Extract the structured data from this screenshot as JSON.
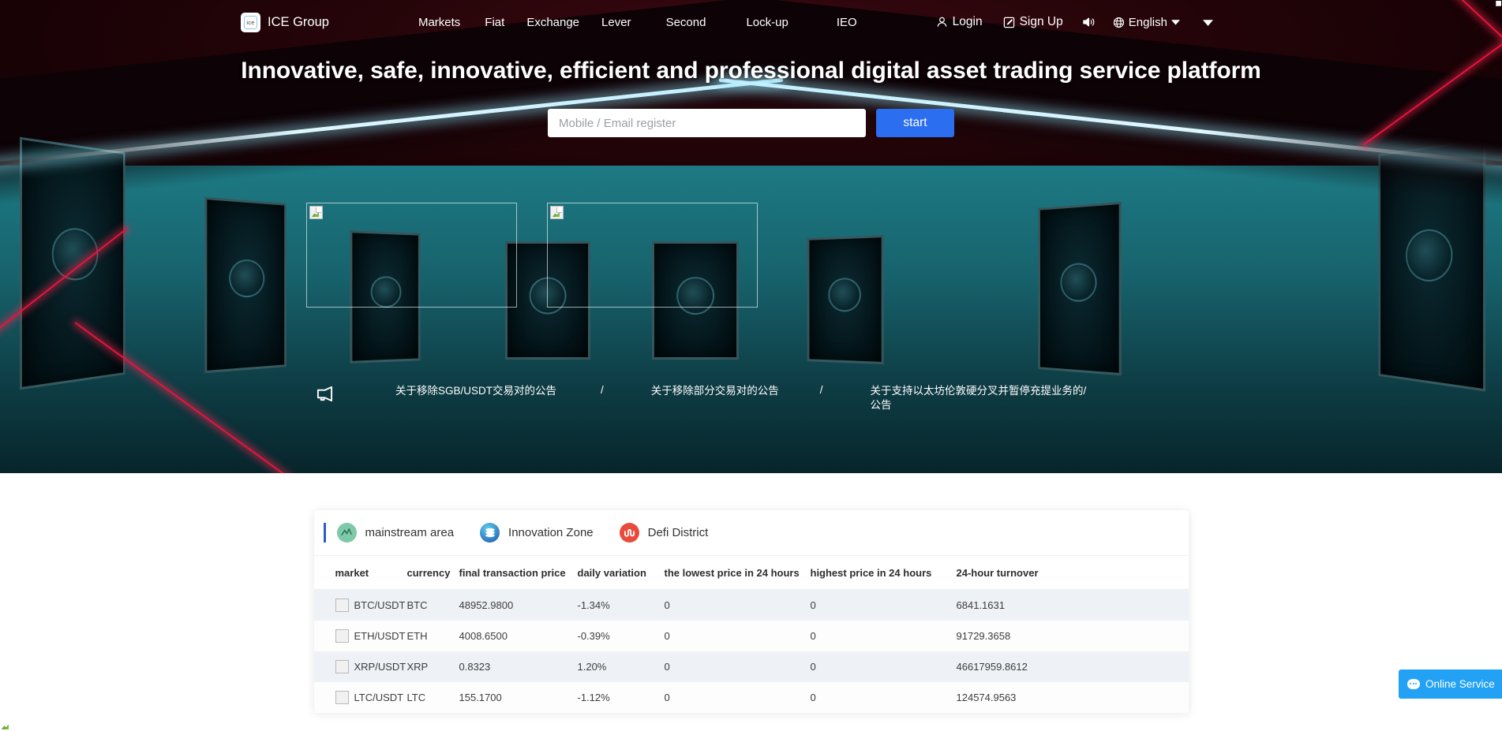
{
  "header": {
    "brand": {
      "logo_text": "ice",
      "name": "ICE Group"
    },
    "nav": [
      {
        "label": "Markets"
      },
      {
        "label": "Fiat"
      },
      {
        "label": "Exchange"
      },
      {
        "label": "Lever"
      },
      {
        "label": "Second"
      },
      {
        "label": "Lock-up"
      },
      {
        "label": "IEO"
      }
    ],
    "login_label": "Login",
    "signup_label": "Sign Up",
    "language_label": "English",
    "icons": {
      "user": "user-icon",
      "pencil": "pencil-icon",
      "sound": "sound-icon",
      "globe": "globe-icon",
      "caret": "chevron-down-icon"
    }
  },
  "hero": {
    "headline": "Innovative, safe, innovative, efficient and professional digital asset trading service platform",
    "register_placeholder": "Mobile / Email register",
    "register_value": "",
    "start_label": "start"
  },
  "announcement": {
    "icon": "megaphone-icon",
    "separator": "/",
    "items": [
      {
        "text": "关于移除SGB/USDT交易对的公告"
      },
      {
        "text": "关于移除部分交易对的公告"
      },
      {
        "text": "关于支持以太坊伦敦硬分叉并暂停充提业务的/公告"
      }
    ]
  },
  "market": {
    "tabs": [
      {
        "label": "mainstream area",
        "icon": "chart-wave-icon",
        "active": true
      },
      {
        "label": "Innovation Zone",
        "icon": "coin-stack-icon",
        "active": false
      },
      {
        "label": "Defi District",
        "icon": "stumbleupon-icon",
        "active": false
      }
    ],
    "columns": [
      "market",
      "currency",
      "final transaction price",
      "daily variation",
      "the lowest price in 24 hours",
      "highest price in 24 hours",
      "24-hour turnover"
    ],
    "rows": [
      {
        "market": "BTC/USDT",
        "currency": "BTC",
        "price": "48952.9800",
        "change": "-1.34%",
        "low24h": "0",
        "high24h": "0",
        "turnover": "6841.1631"
      },
      {
        "market": "ETH/USDT",
        "currency": "ETH",
        "price": "4008.6500",
        "change": "-0.39%",
        "low24h": "0",
        "high24h": "0",
        "turnover": "91729.3658"
      },
      {
        "market": "XRP/USDT",
        "currency": "XRP",
        "price": "0.8323",
        "change": "1.20%",
        "low24h": "0",
        "high24h": "0",
        "turnover": "46617959.8612"
      },
      {
        "market": "LTC/USDT",
        "currency": "LTC",
        "price": "155.1700",
        "change": "-1.12%",
        "low24h": "0",
        "high24h": "0",
        "turnover": "124574.9563"
      }
    ]
  },
  "chat": {
    "label": "Online Service",
    "icon": "chat-bubble-icon"
  },
  "colors": {
    "accent_blue": "#2b6ef0",
    "tab_active": "#2b5ad0",
    "chat_blue": "#23a2f5",
    "laser_red": "#e8133c",
    "room_teal": "#17636d"
  }
}
